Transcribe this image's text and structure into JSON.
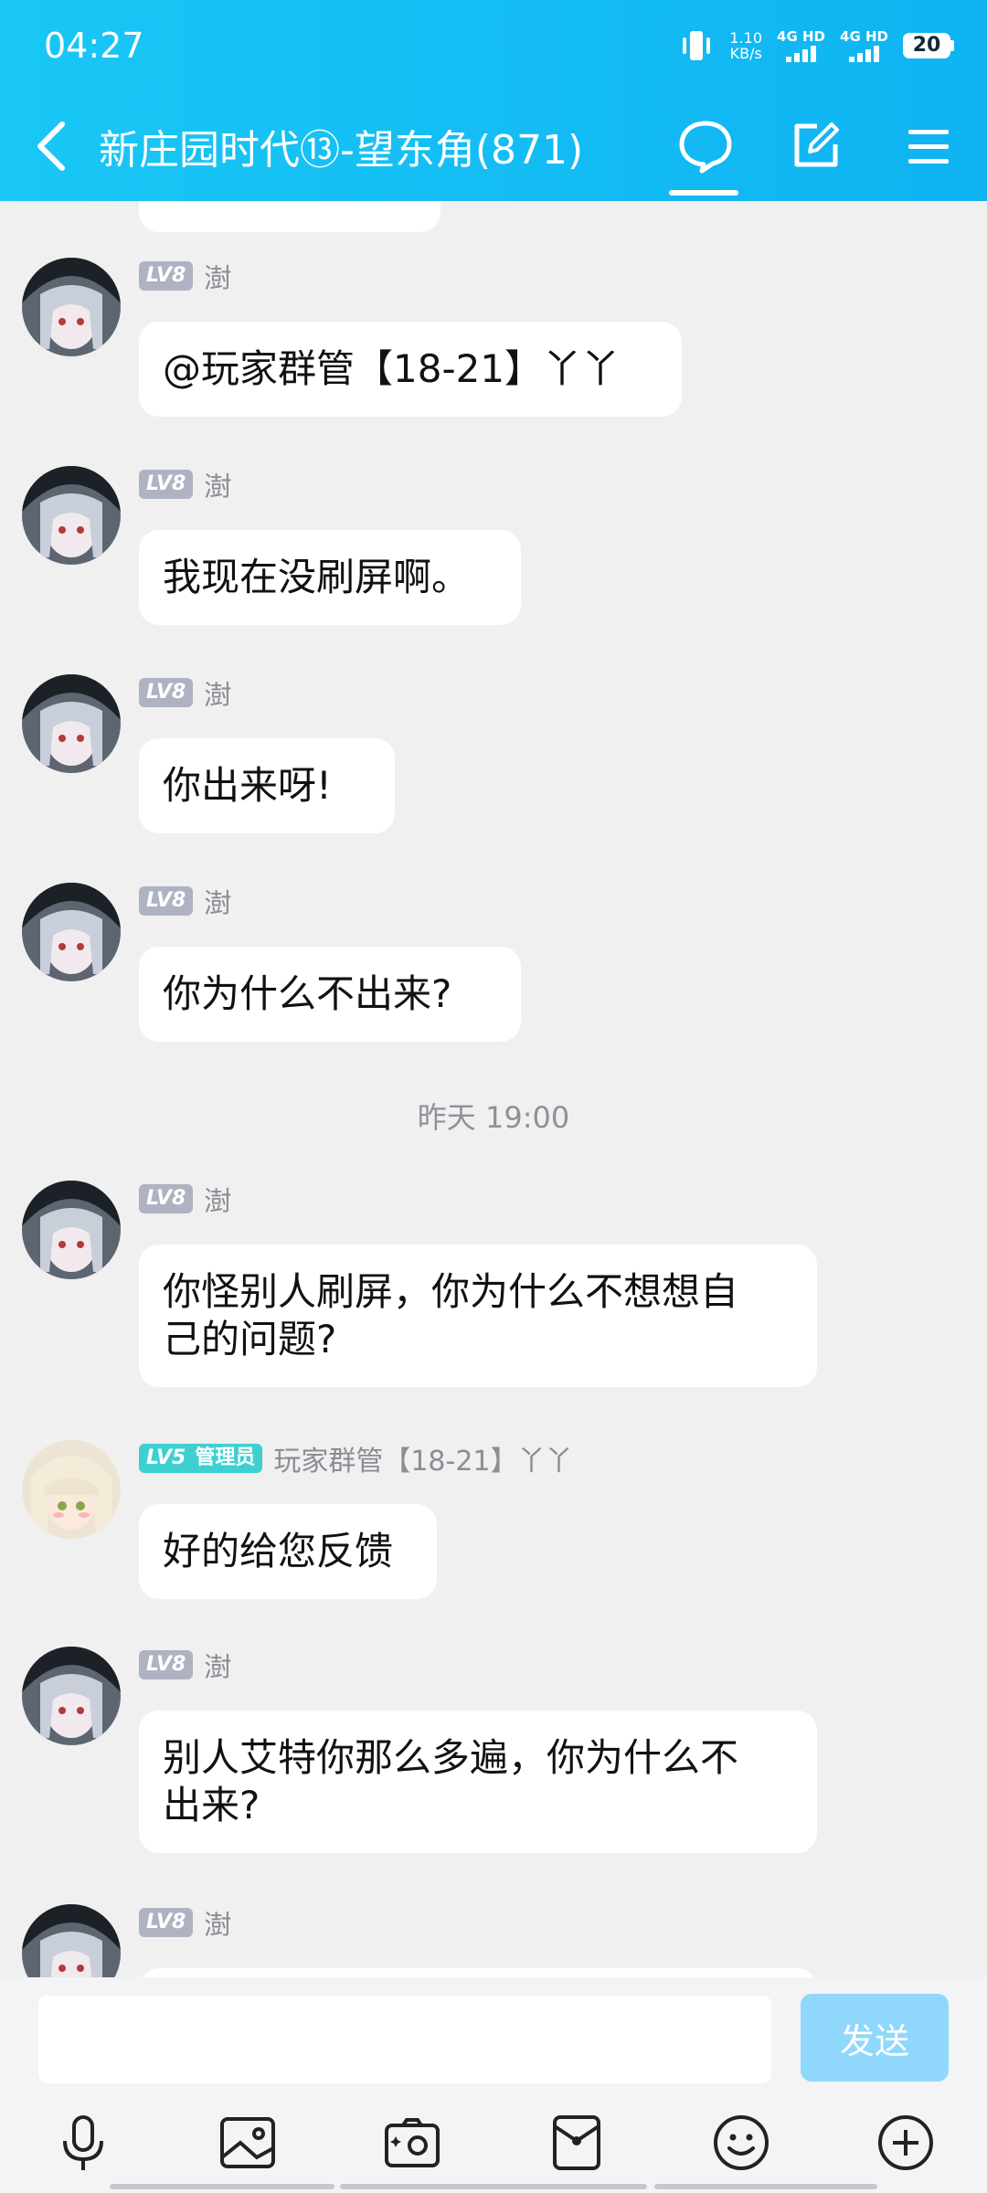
{
  "status_bar": {
    "time": "04:27",
    "net_speed_value": "1.10",
    "net_speed_unit": "KB/s",
    "sim1_label": "4G HD",
    "sim2_label": "4G HD",
    "battery": "20"
  },
  "header": {
    "title": "新庄园时代⑬-望东角(871)"
  },
  "messages": [
    {
      "level": "LV8",
      "nickname": "澍",
      "text": "@玩家群管【18-21】丫丫"
    },
    {
      "level": "LV8",
      "nickname": "澍",
      "text": "我现在没刷屏啊。"
    },
    {
      "level": "LV8",
      "nickname": "澍",
      "text": "你出来呀!"
    },
    {
      "level": "LV8",
      "nickname": "澍",
      "text": "你为什么不出来?"
    },
    {
      "level": "LV8",
      "nickname": "澍",
      "text_line1": "你怪别人刷屏，你为什么不想想自",
      "text_line2": "己的问题?"
    },
    {
      "level": "LV5",
      "role": "管理员",
      "nickname": "玩家群管【18-21】丫丫",
      "text": "好的给您反馈"
    },
    {
      "level": "LV8",
      "nickname": "澍",
      "text_line1": "别人艾特你那么多遍，你为什么不",
      "text_line2": "出来?"
    },
    {
      "level": "LV8",
      "nickname": "澍"
    }
  ],
  "time_divider": "昨天 19:00",
  "input": {
    "value": "",
    "send_label": "发送"
  },
  "colors": {
    "header_gradient_start": "#19c7f5",
    "header_gradient_end": "#0fb3f2",
    "send_button": "#8fd8fb",
    "level_badge": "#aeb3c2",
    "admin_badge": "#3ed0d0"
  },
  "icons": {
    "header": [
      "back-icon",
      "chat-bubble-icon",
      "edit-icon",
      "menu-icon"
    ],
    "toolbar": [
      "microphone-icon",
      "image-icon",
      "camera-icon",
      "red-packet-icon",
      "emoji-icon",
      "plus-icon"
    ]
  }
}
